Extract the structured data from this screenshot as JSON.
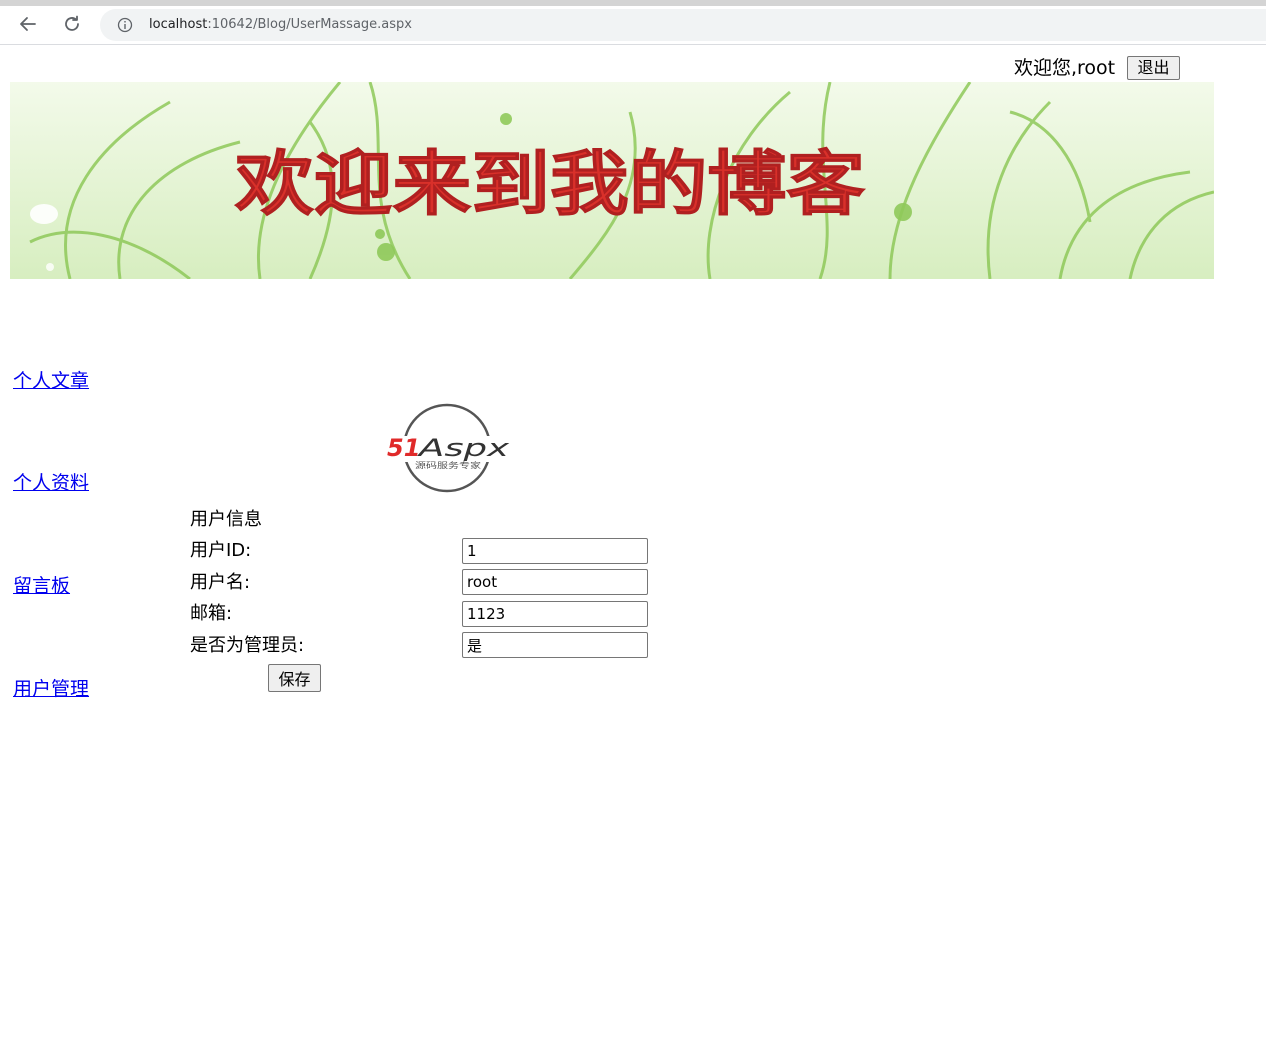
{
  "browser": {
    "url_host": "localhost",
    "url_path": ":10642/Blog/UserMassage.aspx",
    "back_icon": "arrow-left-icon",
    "reload_icon": "reload-icon",
    "info_icon": "info-circle-icon"
  },
  "header": {
    "welcome_text": "欢迎您,root",
    "logout_label": "退出"
  },
  "banner": {
    "title": "欢迎来到我的博客",
    "title_color": "#d9302a",
    "background_color": "#e6f5d3",
    "vine_color": "#8fc95a"
  },
  "sidebar": {
    "items": [
      {
        "label": "个人文章"
      },
      {
        "label": "个人资料"
      },
      {
        "label": "留言板"
      },
      {
        "label": "用户管理"
      }
    ]
  },
  "logo": {
    "brand_prefix": "51",
    "brand_name": "Aspx",
    "tagline": "源码服务专家",
    "red": "#e02a2a",
    "green": "#3aa84a"
  },
  "form": {
    "heading": "用户信息",
    "fields": [
      {
        "label": "用户ID:",
        "value": "1"
      },
      {
        "label": "用户名:",
        "value": "root"
      },
      {
        "label": "邮箱:",
        "value": "1123"
      },
      {
        "label": "是否为管理员:",
        "value": "是"
      }
    ],
    "save_label": "保存"
  }
}
